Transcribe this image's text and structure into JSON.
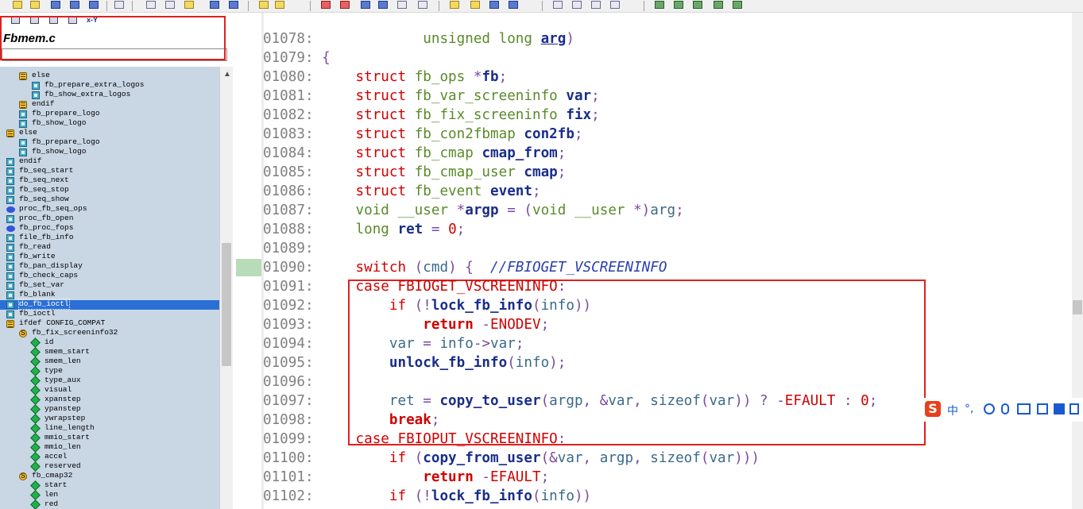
{
  "file_panel": {
    "filename": "Fbmem.c",
    "toolbar_text": "x-Y"
  },
  "tree": [
    {
      "label": "else",
      "icon": "conditional-icon",
      "indent": 1
    },
    {
      "label": "fb_prepare_extra_logos",
      "icon": "function-icon",
      "indent": 2
    },
    {
      "label": "fb_show_extra_logos",
      "icon": "function-icon",
      "indent": 2
    },
    {
      "label": "endif",
      "icon": "conditional-icon",
      "indent": 1
    },
    {
      "label": "fb_prepare_logo",
      "icon": "function-icon",
      "indent": 1
    },
    {
      "label": "fb_show_logo",
      "icon": "function-icon",
      "indent": 1
    },
    {
      "label": "else",
      "icon": "conditional-icon",
      "indent": 0
    },
    {
      "label": "fb_prepare_logo",
      "icon": "function-icon",
      "indent": 1
    },
    {
      "label": "fb_show_logo",
      "icon": "function-icon",
      "indent": 1
    },
    {
      "label": "endif",
      "icon": "function-icon",
      "indent": 0
    },
    {
      "label": "fb_seq_start",
      "icon": "function-icon",
      "indent": 0
    },
    {
      "label": "fb_seq_next",
      "icon": "function-icon",
      "indent": 0
    },
    {
      "label": "fb_seq_stop",
      "icon": "function-icon",
      "indent": 0
    },
    {
      "label": "fb_seq_show",
      "icon": "function-icon",
      "indent": 0
    },
    {
      "label": "proc_fb_seq_ops",
      "icon": "variable-icon",
      "indent": 0
    },
    {
      "label": "proc_fb_open",
      "icon": "function-icon",
      "indent": 0
    },
    {
      "label": "fb_proc_fops",
      "icon": "variable-icon",
      "indent": 0
    },
    {
      "label": "file_fb_info",
      "icon": "function-icon",
      "indent": 0
    },
    {
      "label": "fb_read",
      "icon": "function-icon",
      "indent": 0
    },
    {
      "label": "fb_write",
      "icon": "function-icon",
      "indent": 0
    },
    {
      "label": "fb_pan_display",
      "icon": "function-icon",
      "indent": 0
    },
    {
      "label": "fb_check_caps",
      "icon": "function-icon",
      "indent": 0
    },
    {
      "label": "fb_set_var",
      "icon": "function-icon",
      "indent": 0
    },
    {
      "label": "fb_blank",
      "icon": "function-icon",
      "indent": 0
    },
    {
      "label": "do_fb_ioctl",
      "icon": "function-icon",
      "indent": 0,
      "selected": true
    },
    {
      "label": "fb_ioctl",
      "icon": "function-icon",
      "indent": 0
    },
    {
      "label": "ifdef CONFIG_COMPAT",
      "icon": "conditional-icon",
      "indent": 0
    },
    {
      "label": "fb_fix_screeninfo32",
      "icon": "struct-icon",
      "indent": 1
    },
    {
      "label": "id",
      "icon": "member-icon",
      "indent": 2
    },
    {
      "label": "smem_start",
      "icon": "member-icon",
      "indent": 2
    },
    {
      "label": "smem_len",
      "icon": "member-icon",
      "indent": 2
    },
    {
      "label": "type",
      "icon": "member-icon",
      "indent": 2
    },
    {
      "label": "type_aux",
      "icon": "member-icon",
      "indent": 2
    },
    {
      "label": "visual",
      "icon": "member-icon",
      "indent": 2
    },
    {
      "label": "xpanstep",
      "icon": "member-icon",
      "indent": 2
    },
    {
      "label": "ypanstep",
      "icon": "member-icon",
      "indent": 2
    },
    {
      "label": "ywrapstep",
      "icon": "member-icon",
      "indent": 2
    },
    {
      "label": "line_length",
      "icon": "member-icon",
      "indent": 2
    },
    {
      "label": "mmio_start",
      "icon": "member-icon",
      "indent": 2
    },
    {
      "label": "mmio_len",
      "icon": "member-icon",
      "indent": 2
    },
    {
      "label": "accel",
      "icon": "member-icon",
      "indent": 2
    },
    {
      "label": "reserved",
      "icon": "member-icon",
      "indent": 2
    },
    {
      "label": "fb_cmap32",
      "icon": "struct-icon",
      "indent": 1
    },
    {
      "label": "start",
      "icon": "member-icon",
      "indent": 2
    },
    {
      "label": "len",
      "icon": "member-icon",
      "indent": 2
    },
    {
      "label": "red",
      "icon": "member-icon",
      "indent": 2
    }
  ],
  "code": {
    "lines": [
      {
        "no": "01078:",
        "tokens": [
          [
            "pl",
            "            "
          ],
          [
            "ty",
            "unsigned long "
          ],
          [
            "id ul",
            "arg"
          ],
          [
            "op",
            ")"
          ]
        ]
      },
      {
        "no": "01079:",
        "tokens": [
          [
            "op",
            "{"
          ]
        ]
      },
      {
        "no": "01080:",
        "tokens": [
          [
            "pl",
            "    "
          ],
          [
            "kw",
            "struct "
          ],
          [
            "ty",
            "fb_ops "
          ],
          [
            "op",
            "*"
          ],
          [
            "id",
            "fb"
          ],
          [
            "op",
            ";"
          ]
        ]
      },
      {
        "no": "01081:",
        "tokens": [
          [
            "pl",
            "    "
          ],
          [
            "kw",
            "struct "
          ],
          [
            "ty",
            "fb_var_screeninfo "
          ],
          [
            "id",
            "var"
          ],
          [
            "op",
            ";"
          ]
        ]
      },
      {
        "no": "01082:",
        "tokens": [
          [
            "pl",
            "    "
          ],
          [
            "kw",
            "struct "
          ],
          [
            "ty",
            "fb_fix_screeninfo "
          ],
          [
            "id",
            "fix"
          ],
          [
            "op",
            ";"
          ]
        ]
      },
      {
        "no": "01083:",
        "tokens": [
          [
            "pl",
            "    "
          ],
          [
            "kw",
            "struct "
          ],
          [
            "ty",
            "fb_con2fbmap "
          ],
          [
            "id",
            "con2fb"
          ],
          [
            "op",
            ";"
          ]
        ]
      },
      {
        "no": "01084:",
        "tokens": [
          [
            "pl",
            "    "
          ],
          [
            "kw",
            "struct "
          ],
          [
            "ty",
            "fb_cmap "
          ],
          [
            "id",
            "cmap_from"
          ],
          [
            "op",
            ";"
          ]
        ]
      },
      {
        "no": "01085:",
        "tokens": [
          [
            "pl",
            "    "
          ],
          [
            "kw",
            "struct "
          ],
          [
            "ty",
            "fb_cmap_user "
          ],
          [
            "id",
            "cmap"
          ],
          [
            "op",
            ";"
          ]
        ]
      },
      {
        "no": "01086:",
        "tokens": [
          [
            "pl",
            "    "
          ],
          [
            "kw",
            "struct "
          ],
          [
            "ty",
            "fb_event "
          ],
          [
            "id",
            "event"
          ],
          [
            "op",
            ";"
          ]
        ]
      },
      {
        "no": "01087:",
        "tokens": [
          [
            "pl",
            "    "
          ],
          [
            "ty",
            "void __user "
          ],
          [
            "op",
            "*"
          ],
          [
            "id",
            "argp"
          ],
          [
            "op",
            " = ("
          ],
          [
            "ty",
            "void __user "
          ],
          [
            "op",
            "*)"
          ],
          [
            "pl",
            "arg"
          ],
          [
            "op",
            ";"
          ]
        ]
      },
      {
        "no": "01088:",
        "tokens": [
          [
            "pl",
            "    "
          ],
          [
            "ty",
            "long "
          ],
          [
            "id",
            "ret"
          ],
          [
            "op",
            " = "
          ],
          [
            "nm",
            "0"
          ],
          [
            "op",
            ";"
          ]
        ]
      },
      {
        "no": "01089:",
        "tokens": []
      },
      {
        "no": "01090:",
        "tokens": [
          [
            "pl",
            "    "
          ],
          [
            "kw",
            "switch "
          ],
          [
            "op",
            "("
          ],
          [
            "pl",
            "cmd"
          ],
          [
            "op",
            ") {  "
          ],
          [
            "cm",
            "//FBIOGET_VSCREENINFO"
          ]
        ]
      },
      {
        "no": "01091:",
        "tokens": [
          [
            "pl",
            "    "
          ],
          [
            "kw",
            "case "
          ],
          [
            "kw",
            "FBIOGET_VSCREENINFO"
          ],
          [
            "op",
            ":"
          ]
        ]
      },
      {
        "no": "01092:",
        "tokens": [
          [
            "pl",
            "        "
          ],
          [
            "kw",
            "if "
          ],
          [
            "op",
            "(!"
          ],
          [
            "id",
            "lock_fb_info"
          ],
          [
            "op",
            "("
          ],
          [
            "pl",
            "info"
          ],
          [
            "op",
            "))"
          ]
        ]
      },
      {
        "no": "01093:",
        "tokens": [
          [
            "pl",
            "            "
          ],
          [
            "kw2",
            "return "
          ],
          [
            "op",
            "-"
          ],
          [
            "kw",
            "ENODEV"
          ],
          [
            "op",
            ";"
          ]
        ]
      },
      {
        "no": "01094:",
        "tokens": [
          [
            "pl",
            "        "
          ],
          [
            "pl",
            "var "
          ],
          [
            "op",
            "= "
          ],
          [
            "pl",
            "info"
          ],
          [
            "op",
            "->"
          ],
          [
            "pl",
            "var"
          ],
          [
            "op",
            ";"
          ]
        ]
      },
      {
        "no": "01095:",
        "tokens": [
          [
            "pl",
            "        "
          ],
          [
            "id",
            "unlock_fb_info"
          ],
          [
            "op",
            "("
          ],
          [
            "pl",
            "info"
          ],
          [
            "op",
            ");"
          ]
        ]
      },
      {
        "no": "01096:",
        "tokens": []
      },
      {
        "no": "01097:",
        "tokens": [
          [
            "pl",
            "        "
          ],
          [
            "pl",
            "ret "
          ],
          [
            "op",
            "= "
          ],
          [
            "id",
            "copy_to_user"
          ],
          [
            "op",
            "("
          ],
          [
            "pl",
            "argp"
          ],
          [
            "op",
            ", &"
          ],
          [
            "pl",
            "var"
          ],
          [
            "op",
            ", "
          ],
          [
            "pl",
            "sizeof"
          ],
          [
            "op",
            "("
          ],
          [
            "pl",
            "var"
          ],
          [
            "op",
            ")) ? -"
          ],
          [
            "kw",
            "EFAULT "
          ],
          [
            "op",
            ": "
          ],
          [
            "nm",
            "0"
          ],
          [
            "op",
            ";"
          ]
        ]
      },
      {
        "no": "01098:",
        "tokens": [
          [
            "pl",
            "        "
          ],
          [
            "kw2",
            "break"
          ],
          [
            "op",
            ";"
          ]
        ]
      },
      {
        "no": "01099:",
        "tokens": [
          [
            "pl",
            "    "
          ],
          [
            "kw",
            "case "
          ],
          [
            "kw",
            "FBIOPUT_VSCREENINFO"
          ],
          [
            "op",
            ":"
          ]
        ]
      },
      {
        "no": "01100:",
        "tokens": [
          [
            "pl",
            "        "
          ],
          [
            "kw",
            "if "
          ],
          [
            "op",
            "("
          ],
          [
            "id",
            "copy_from_user"
          ],
          [
            "op",
            "(&"
          ],
          [
            "pl",
            "var"
          ],
          [
            "op",
            ", "
          ],
          [
            "pl",
            "argp"
          ],
          [
            "op",
            ", "
          ],
          [
            "pl",
            "sizeof"
          ],
          [
            "op",
            "("
          ],
          [
            "pl",
            "var"
          ],
          [
            "op",
            ")))"
          ]
        ]
      },
      {
        "no": "01101:",
        "tokens": [
          [
            "pl",
            "            "
          ],
          [
            "kw2",
            "return "
          ],
          [
            "op",
            "-"
          ],
          [
            "kw",
            "EFAULT"
          ],
          [
            "op",
            ";"
          ]
        ]
      },
      {
        "no": "01102:",
        "tokens": [
          [
            "pl",
            "        "
          ],
          [
            "kw",
            "if "
          ],
          [
            "op",
            "(!"
          ],
          [
            "id",
            "lock_fb_info"
          ],
          [
            "op",
            "("
          ],
          [
            "pl",
            "info"
          ],
          [
            "op",
            "))"
          ]
        ]
      }
    ]
  },
  "ime_bar": {
    "logo": "S",
    "mode": "中",
    "punct": "°,"
  },
  "colors": {
    "tree_bg": "#c9d6e4",
    "selection": "#2b6fd6",
    "highlight_box": "#e02020",
    "keyword": "#d00000",
    "type": "#5a8a2a",
    "identifier": "#1a2d8a"
  }
}
